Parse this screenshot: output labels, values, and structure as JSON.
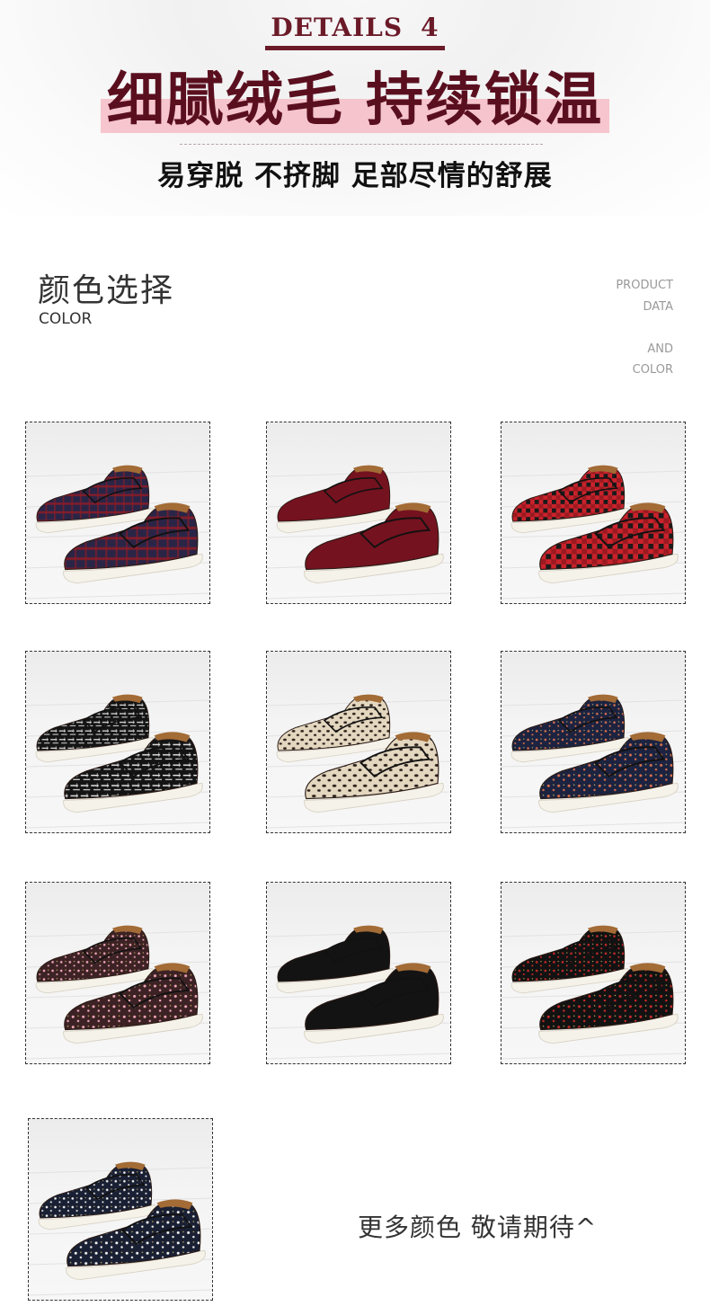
{
  "header": {
    "details_label": "DETAILS",
    "details_number": "4",
    "headline": "细腻绒毛 持续锁温",
    "subline": "易穿脱 不挤脚 足部尽情的舒展",
    "accent_color": "#6b1a28",
    "highlight_color": "#f6b4bf"
  },
  "color_section": {
    "title_cn": "颜色选择",
    "title_en": "COLOR",
    "side_text": [
      "PRODUCT",
      "DATA",
      "AND",
      "COLOR"
    ]
  },
  "swatches": [
    {
      "pattern": "navy-red-tartan",
      "colors": [
        "#2a2547",
        "#8f1b24"
      ]
    },
    {
      "pattern": "solid-burgundy",
      "colors": [
        "#7e1422",
        "#5a0d18"
      ]
    },
    {
      "pattern": "red-black-gingham",
      "colors": [
        "#c9222b",
        "#1a1a1a"
      ]
    },
    {
      "pattern": "black-white-tweed",
      "colors": [
        "#141414",
        "#e8e8e8"
      ]
    },
    {
      "pattern": "leopard-print",
      "colors": [
        "#e4d7c0",
        "#2b211a"
      ]
    },
    {
      "pattern": "navy-floral",
      "colors": [
        "#1c2340",
        "#d9704e"
      ]
    },
    {
      "pattern": "dark-pink-floral",
      "colors": [
        "#3c2224",
        "#f0a7b8"
      ]
    },
    {
      "pattern": "solid-black",
      "colors": [
        "#161616",
        "#0c0c0c"
      ]
    },
    {
      "pattern": "black-red-rose",
      "colors": [
        "#121212",
        "#c92a2a"
      ]
    },
    {
      "pattern": "navy-white-ditsy",
      "colors": [
        "#1a2034",
        "#f0f0f0"
      ]
    }
  ],
  "footer_note": "更多颜色 敬请期待^"
}
